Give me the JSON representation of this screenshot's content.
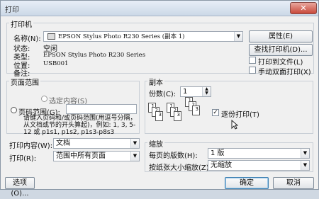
{
  "window": {
    "title": "打印",
    "close_glyph": "✕"
  },
  "printer": {
    "group_title": "打印机",
    "name_label": "名称(N):",
    "name_value": "EPSON Stylus Photo R230 Series (副本 1)",
    "properties_button": "属性(E)",
    "status_label": "状态:",
    "status_value": "空闲",
    "type_label": "类型:",
    "type_value": "EPSON Stylus Photo R230 Series",
    "location_label": "位置:",
    "location_value": "USB001",
    "comment_label": "备注:",
    "find_button": "查找打印机(D)...",
    "print_to_file": "打印到文件(L)",
    "manual_duplex": "手动双面打印(X)"
  },
  "page_range": {
    "group_title": "页面范围",
    "selection_label": "选定内容(S)",
    "pages_label": "页码范围(G):",
    "help_text": "请键入页码和/或页码范围(用逗号分隔，从文档或节的开头算起)，例如: 1, 3, 5-12 或 p1s1, p1s2, p1s3-p8s3"
  },
  "print_what": {
    "label": "打印内容(W):",
    "value": "文档"
  },
  "print_mode": {
    "label": "打印(R):",
    "value": "范围中所有页面"
  },
  "copies": {
    "group_title": "副本",
    "count_label": "份数(C):",
    "count_value": "1",
    "collate_label": "逐份打印(T)",
    "collate_checked": true
  },
  "zoom": {
    "group_title": "缩放",
    "pages_per_sheet_label": "每页的版数(H):",
    "pages_per_sheet_value": "1 版",
    "scale_label": "按纸张大小缩放(Z):",
    "scale_value": "无缩放"
  },
  "footer": {
    "options_button": "选项(O)...",
    "ok_button": "确定",
    "cancel_button": "取消"
  },
  "colors": {
    "title_bar": "#cbd8e7",
    "close_button": "#c8483a"
  }
}
